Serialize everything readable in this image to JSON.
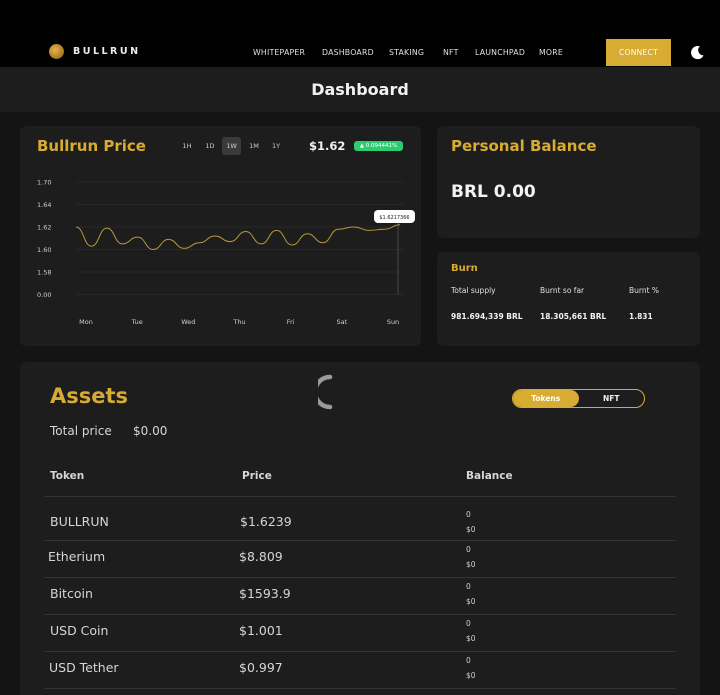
{
  "header": {
    "brand": "BULLRUN",
    "nav": [
      "WHITEPAPER",
      "DASHBOARD",
      "STAKING",
      "NFT",
      "LAUNCHPAD",
      "MORE"
    ],
    "connect_label": "CONNECT",
    "theme_icon": "moon-icon"
  },
  "page": {
    "title": "Dashboard"
  },
  "price_card": {
    "title": "Bullrun  Price",
    "timeframes": [
      "1H",
      "1D",
      "1W",
      "1M",
      "1Y"
    ],
    "active_timeframe": "1W",
    "price": "$1.62",
    "change": "▲ 0.094441%",
    "change_color": "#2ecc71",
    "tooltip": "$1.6217366"
  },
  "chart_data": {
    "type": "line",
    "title": "Bullrun  Price",
    "xlabel": "",
    "ylabel": "",
    "x": [
      "Mon",
      "Tue",
      "Wed",
      "Thu",
      "Fri",
      "Sat",
      "Sun"
    ],
    "y_ticks": [
      "1.70",
      "1.64",
      "1.62",
      "1.60",
      "1.58",
      "0.00"
    ],
    "y_tick_values": [
      1.7,
      1.64,
      1.62,
      1.6,
      1.58,
      0.0
    ],
    "grid": true,
    "line_color": "#b8963a",
    "series": [
      {
        "values": [
          1.62,
          1.603,
          1.619,
          1.605,
          1.611,
          1.6,
          1.609,
          1.601,
          1.606,
          1.612,
          1.607,
          1.616,
          1.605,
          1.617,
          1.604,
          1.614,
          1.606,
          1.618,
          1.62,
          1.617,
          1.618,
          1.622
        ]
      }
    ]
  },
  "personal_balance": {
    "title": "Personal Balance",
    "value": "BRL 0.00"
  },
  "burn": {
    "title": "Burn",
    "labels": [
      "Total supply",
      "Burnt so far",
      "Burnt %"
    ],
    "values": [
      "981.694,339 BRL",
      "18.305,661 BRL",
      "1.831"
    ]
  },
  "assets": {
    "title": "Assets",
    "total_label": "Total price",
    "total_value": "$0.00",
    "tabs": [
      "Tokens",
      "NFT"
    ],
    "active_tab": "Tokens",
    "columns": [
      "Token",
      "Price",
      "Balance"
    ],
    "rows": [
      {
        "token": "BULLRUN",
        "price": "$1.6239",
        "balance": "0",
        "balance_usd": "$0"
      },
      {
        "token": "Etherium",
        "price": "$8.809",
        "balance": "0",
        "balance_usd": "$0"
      },
      {
        "token": "Bitcoin",
        "price": "$1593.9",
        "balance": "0",
        "balance_usd": "$0"
      },
      {
        "token": "USD Coin",
        "price": "$1.001",
        "balance": "0",
        "balance_usd": "$0"
      },
      {
        "token": "USD Tether",
        "price": "$0.997",
        "balance": "0",
        "balance_usd": "$0"
      }
    ]
  },
  "colors": {
    "accent": "#d8ac32",
    "background": "#141414",
    "card": "#1d1d1d"
  }
}
